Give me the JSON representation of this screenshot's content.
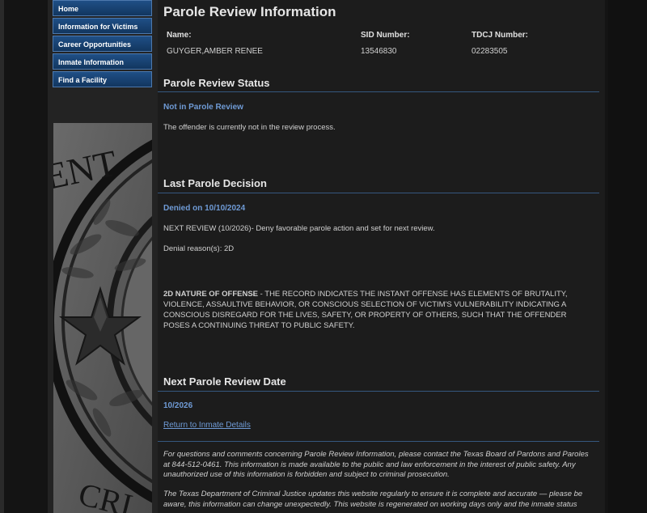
{
  "nav": {
    "items": [
      {
        "label": "Home"
      },
      {
        "label": "Information for Victims"
      },
      {
        "label": "Career Opportunities"
      },
      {
        "label": "Inmate Information"
      },
      {
        "label": "Find a Facility"
      }
    ]
  },
  "seal": {
    "text_top": "ENT",
    "text_bottom": "CRI"
  },
  "page": {
    "title": "Parole Review Information"
  },
  "offender": {
    "name_label": "Name:",
    "name": "GUYGER,AMBER RENEE",
    "sid_label": "SID Number:",
    "sid": "13546830",
    "tdcj_label": "TDCJ Number:",
    "tdcj": "02283505"
  },
  "review_status": {
    "title": "Parole Review Status",
    "status": "Not in Parole Review",
    "text": "The offender is currently not in the review process."
  },
  "last_decision": {
    "title": "Last Parole Decision",
    "decision": "Denied on 10/10/2024",
    "next_review": "NEXT REVIEW (10/2026)- Deny favorable parole action and set for next review.",
    "denial_reasons": "Denial reason(s): 2D",
    "reason_code": "2D NATURE OF OFFENSE",
    "reason_text": " - THE RECORD INDICATES THE INSTANT OFFENSE HAS ELEMENTS OF BRUTALITY, VIOLENCE, ASSAULTIVE BEHAVIOR, OR CONSCIOUS SELECTION OF VICTIM'S VULNERABILITY INDICATING A CONSCIOUS DISREGARD FOR THE LIVES, SAFETY, OR PROPERTY OF OTHERS, SUCH THAT THE OFFENDER POSES A CONTINUING THREAT TO PUBLIC SAFETY."
  },
  "next_review_date": {
    "title": "Next Parole Review Date",
    "date": "10/2026",
    "return_link": "Return to Inmate Details"
  },
  "footer": {
    "p1": "For questions and comments concerning Parole Review Information, please contact the Texas Board of Pardons and Paroles at 844-512-0461. This information is made available to the public and law enforcement in the interest of public safety. Any unauthorized use of this information is forbidden and subject to criminal prosecution.",
    "p2": "The Texas Department of Criminal Justice updates this website regularly to ensure it is complete and accurate — please be aware, this information can change unexpectedly. This website is regenerated on working days only and the inmate status"
  }
}
